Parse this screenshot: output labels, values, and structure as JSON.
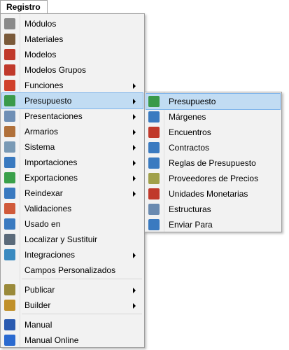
{
  "menubar": {
    "registro": "Registro"
  },
  "main_menu": [
    {
      "label": "Módulos",
      "icon": "modules-icon",
      "color": "#8a8a8a",
      "arrow": false
    },
    {
      "label": "Materiales",
      "icon": "materials-icon",
      "color": "#7a5a3a",
      "arrow": false
    },
    {
      "label": "Modelos",
      "icon": "models-icon",
      "color": "#c0392b",
      "arrow": false
    },
    {
      "label": "Modelos Grupos",
      "icon": "model-groups-icon",
      "color": "#c0392b",
      "arrow": false
    },
    {
      "label": "Funciones",
      "icon": "functions-icon",
      "color": "#d0402a",
      "arrow": true
    },
    {
      "label": "Presupuesto",
      "icon": "budget-icon",
      "color": "#3a9a4a",
      "arrow": true,
      "highlight": true
    },
    {
      "label": "Presentaciones",
      "icon": "presentations-icon",
      "color": "#6f8fb5",
      "arrow": true
    },
    {
      "label": "Armarios",
      "icon": "wardrobes-icon",
      "color": "#b0703a",
      "arrow": true
    },
    {
      "label": "Sistema",
      "icon": "system-gear-icon",
      "color": "#7a9ab5",
      "arrow": true
    },
    {
      "label": "Importaciones",
      "icon": "import-icon",
      "color": "#3a7ac0",
      "arrow": true
    },
    {
      "label": "Exportaciones",
      "icon": "export-icon",
      "color": "#3aa04a",
      "arrow": true
    },
    {
      "label": "Reindexar",
      "icon": "reindex-icon",
      "color": "#3a7ac0",
      "arrow": true
    },
    {
      "label": "Validaciones",
      "icon": "validations-icon",
      "color": "#d05a3a",
      "arrow": false
    },
    {
      "label": "Usado en",
      "icon": "used-in-icon",
      "color": "#3a7ac0",
      "arrow": false
    },
    {
      "label": "Localizar y Sustituir",
      "icon": "find-replace-icon",
      "color": "#5a6a7a",
      "arrow": false
    },
    {
      "label": "Integraciones",
      "icon": "integrations-icon",
      "color": "#3a8ac0",
      "arrow": true
    },
    {
      "label": "Campos Personalizados",
      "icon": "",
      "color": "",
      "arrow": false
    },
    {
      "label": "Publicar",
      "icon": "publish-icon",
      "color": "#9a8a3a",
      "arrow": true
    },
    {
      "label": "Builder",
      "icon": "builder-icon",
      "color": "#c0902a",
      "arrow": true
    },
    {
      "label": "Manual",
      "icon": "manual-book-icon",
      "color": "#2a5ab0",
      "arrow": false
    },
    {
      "label": "Manual Online",
      "icon": "help-icon",
      "color": "#2a6ad0",
      "arrow": false
    }
  ],
  "sub_menu": [
    {
      "label": "Presupuesto",
      "icon": "budget-icon",
      "color": "#3a9a4a",
      "highlight": true
    },
    {
      "label": "Márgenes",
      "icon": "margins-icon",
      "color": "#3a7ac0"
    },
    {
      "label": "Encuentros",
      "icon": "encounters-icon",
      "color": "#c0392b"
    },
    {
      "label": "Contractos",
      "icon": "contracts-icon",
      "color": "#3a7ac0"
    },
    {
      "label": "Reglas de Presupuesto",
      "icon": "budget-rules-icon",
      "color": "#3a7ac0"
    },
    {
      "label": "Proveedores de Precios",
      "icon": "price-providers-icon",
      "color": "#a0a04a"
    },
    {
      "label": "Unidades Monetarias",
      "icon": "currency-units-icon",
      "color": "#c0392b"
    },
    {
      "label": "Estructuras",
      "icon": "structures-icon",
      "color": "#6a8ab0"
    },
    {
      "label": "Enviar Para",
      "icon": "send-to-icon",
      "color": "#3a7ac0"
    }
  ]
}
